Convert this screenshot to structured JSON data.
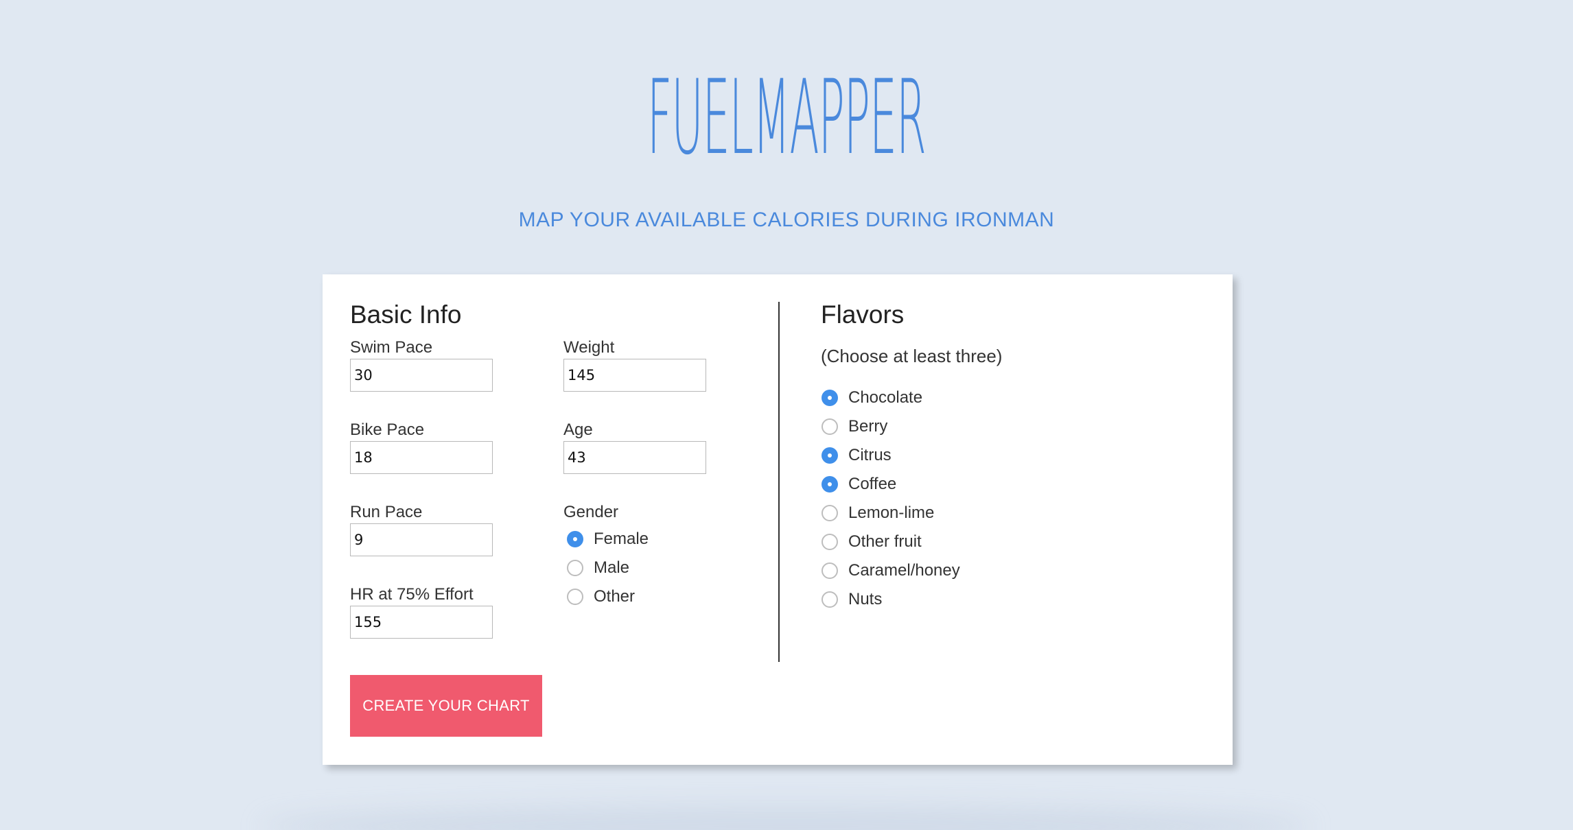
{
  "header": {
    "logo_text": "FUELMAPPER",
    "tagline": "MAP YOUR AVAILABLE CALORIES DURING IRONMAN"
  },
  "basic_info": {
    "title": "Basic Info",
    "swim_pace": {
      "label": "Swim Pace",
      "value": "30"
    },
    "weight": {
      "label": "Weight",
      "value": "145"
    },
    "bike_pace": {
      "label": "Bike Pace",
      "value": "18"
    },
    "age": {
      "label": "Age",
      "value": "43"
    },
    "run_pace": {
      "label": "Run Pace",
      "value": "9"
    },
    "hr_effort": {
      "label": "HR at 75% Effort",
      "value": "155"
    },
    "gender": {
      "label": "Gender",
      "options": [
        {
          "label": "Female",
          "checked": true
        },
        {
          "label": "Male",
          "checked": false
        },
        {
          "label": "Other",
          "checked": false
        }
      ]
    }
  },
  "flavors": {
    "title": "Flavors",
    "subtitle": "(Choose at least three)",
    "options": [
      {
        "label": "Chocolate",
        "checked": true
      },
      {
        "label": "Berry",
        "checked": false
      },
      {
        "label": "Citrus",
        "checked": true
      },
      {
        "label": "Coffee",
        "checked": true
      },
      {
        "label": "Lemon-lime",
        "checked": false
      },
      {
        "label": "Other fruit",
        "checked": false
      },
      {
        "label": "Caramel/honey",
        "checked": false
      },
      {
        "label": "Nuts",
        "checked": false
      }
    ]
  },
  "actions": {
    "create_chart_label": "CREATE YOUR CHART"
  },
  "colors": {
    "background": "#e0e8f2",
    "accent_blue": "#4a89dc",
    "radio_checked": "#3f8fea",
    "button": "#f05a6e"
  }
}
